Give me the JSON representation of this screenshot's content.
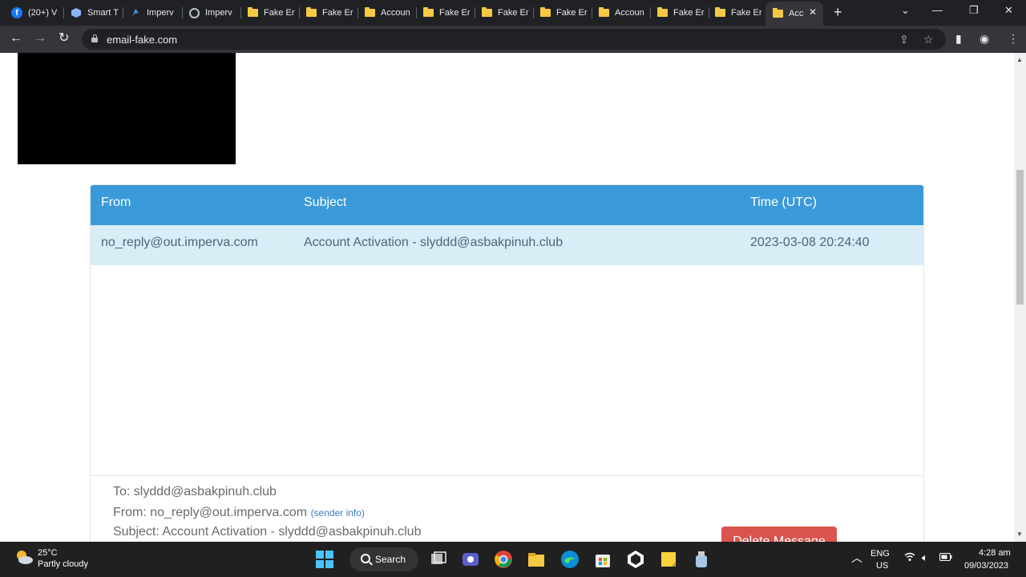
{
  "browser": {
    "tabs": [
      {
        "label": "(20+) V",
        "icon": "facebook-icon"
      },
      {
        "label": "Smart T",
        "icon": "app-icon"
      },
      {
        "label": "Imperv",
        "icon": "imperva-icon"
      },
      {
        "label": "Imperv",
        "icon": "globe-icon"
      },
      {
        "label": "Fake Er",
        "icon": "folder-icon"
      },
      {
        "label": "Fake Er",
        "icon": "folder-icon"
      },
      {
        "label": "Accoun",
        "icon": "folder-icon"
      },
      {
        "label": "Fake Er",
        "icon": "folder-icon"
      },
      {
        "label": "Fake Er",
        "icon": "folder-icon"
      },
      {
        "label": "Fake Er",
        "icon": "folder-icon"
      },
      {
        "label": "Accoun",
        "icon": "folder-icon"
      },
      {
        "label": "Fake Er",
        "icon": "folder-icon"
      },
      {
        "label": "Fake Er",
        "icon": "folder-icon"
      },
      {
        "label": "Acc",
        "icon": "folder-icon",
        "active": true
      }
    ],
    "url": "email-fake.com"
  },
  "inbox": {
    "headers": {
      "from": "From",
      "subject": "Subject",
      "time": "Time (UTC)"
    },
    "row": {
      "from": "no_reply@out.imperva.com",
      "subject": "Account Activation - slyddd@asbakpinuh.club",
      "time": "2023-03-08 20:24:40"
    }
  },
  "message": {
    "to": "To: slyddd@asbakpinuh.club",
    "from": "From: no_reply@out.imperva.com",
    "sender_info": "(sender info)",
    "subject": "Subject: Account Activation - slyddd@asbakpinuh.club",
    "delete_label": "Delete Message"
  },
  "taskbar": {
    "temp": "25°C",
    "weather": "Partly cloudy",
    "search_label": "Search",
    "lang_1": "ENG",
    "lang_2": "US",
    "time": "4:28 am",
    "date": "09/03/2023"
  },
  "colors": {
    "header_blue": "#3a9ad9",
    "row_highlight": "#d9edf7",
    "delete_red": "#d9534f"
  }
}
